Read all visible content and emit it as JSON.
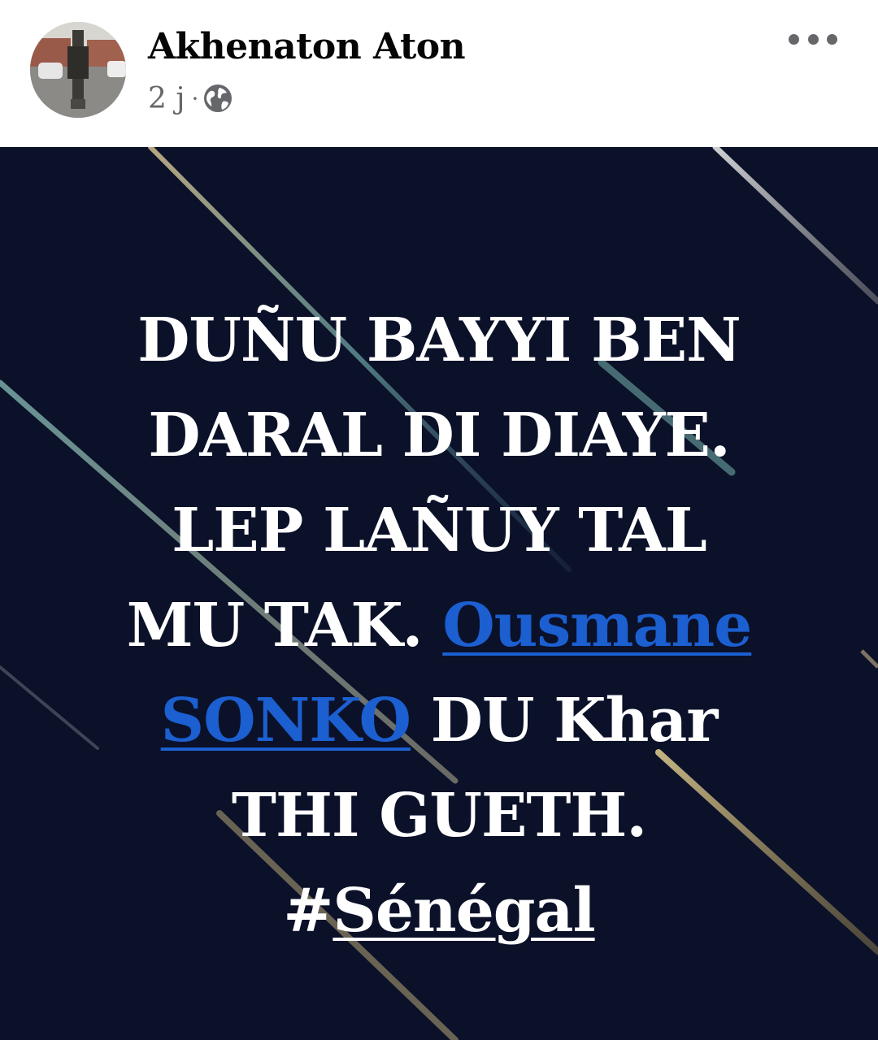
{
  "post": {
    "author_name": "Akhenaton Aton",
    "time_ago": "2 j",
    "meta_separator": "·",
    "privacy_icon": "globe-icon",
    "more_icon": "more-horizontal-icon"
  },
  "image_text": {
    "line1": "DUÑU BAYYI BEN",
    "line2": "DARAL DI DIAYE.",
    "line3": "LEP LAÑUY TAL",
    "line4_prefix": "MU TAK. ",
    "mention_part1": "Ousmane",
    "mention_part2": "SONKO",
    "line5_suffix": " DU Khar",
    "line6": "THI GUETH.",
    "hashtag_symbol": "#",
    "hashtag_text": "Sénégal"
  },
  "colors": {
    "background": "#0b1129",
    "mention": "#1b5fd0",
    "text": "#ffffff",
    "meta": "#65676b"
  }
}
